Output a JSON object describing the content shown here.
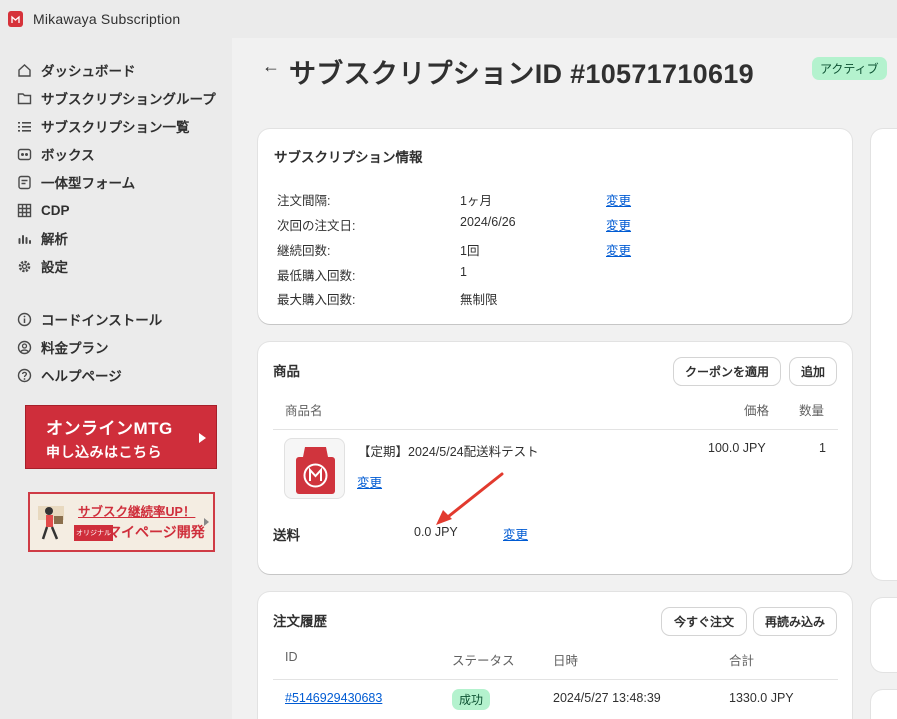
{
  "app": {
    "title": "Mikawaya Subscription"
  },
  "sidebar": {
    "items": [
      {
        "label": "ダッシュボード",
        "icon": "home-icon"
      },
      {
        "label": "サブスクリプショングループ",
        "icon": "folder-icon"
      },
      {
        "label": "サブスクリプション一覧",
        "icon": "list-icon"
      },
      {
        "label": "ボックス",
        "icon": "box-icon"
      },
      {
        "label": "一体型フォーム",
        "icon": "form-icon"
      },
      {
        "label": "CDP",
        "icon": "grid-icon"
      },
      {
        "label": "解析",
        "icon": "chart-icon"
      },
      {
        "label": "設定",
        "icon": "gear-icon"
      }
    ],
    "items2": [
      {
        "label": "コードインストール",
        "icon": "info-icon"
      },
      {
        "label": "料金プラン",
        "icon": "user-circle-icon"
      },
      {
        "label": "ヘルプページ",
        "icon": "help-icon"
      }
    ],
    "banner_mtg": {
      "line1": "オンラインMTG",
      "line2": "申し込みはこちら"
    },
    "banner_mypage": {
      "line1": "サブスク継続率UP！",
      "tag": "オリジナル",
      "line2": "マイページ開発"
    }
  },
  "header": {
    "back": "←",
    "title": "サブスクリプションID #10571710619",
    "status": "アクティブ"
  },
  "info": {
    "title": "サブスクリプション情報",
    "rows": [
      {
        "label": "注文間隔:",
        "value": "1ヶ月",
        "action": "変更"
      },
      {
        "label": "次回の注文日:",
        "value": "2024/6/26",
        "action": "変更"
      },
      {
        "label": "継続回数:",
        "value": "1回",
        "action": "変更"
      },
      {
        "label": "最低購入回数:",
        "value": "1",
        "action": ""
      },
      {
        "label": "最大購入回数:",
        "value": "無制限",
        "action": ""
      }
    ]
  },
  "products": {
    "title": "商品",
    "coupon_button": "クーポンを適用",
    "add_button": "追加",
    "headers": {
      "name": "商品名",
      "price": "価格",
      "qty": "数量"
    },
    "item": {
      "name": "【定期】2024/5/24配送料テスト",
      "price": "100.0 JPY",
      "qty": "1",
      "change": "変更"
    },
    "shipping_label": "送料",
    "shipping_value": "0.0 JPY",
    "shipping_change": "変更"
  },
  "orders": {
    "title": "注文履歴",
    "order_now_button": "今すぐ注文",
    "reload_button": "再読み込み",
    "headers": {
      "id": "ID",
      "status": "ステータス",
      "date": "日時",
      "total": "合計"
    },
    "rows": [
      {
        "id": "#5146929430683",
        "status": "成功",
        "date": "2024/5/27 13:48:39",
        "total": "1330.0 JPY"
      }
    ]
  },
  "colors": {
    "accent_red": "#cf2e3b",
    "link": "#005bd3",
    "success_bg": "#b4f2ce"
  }
}
